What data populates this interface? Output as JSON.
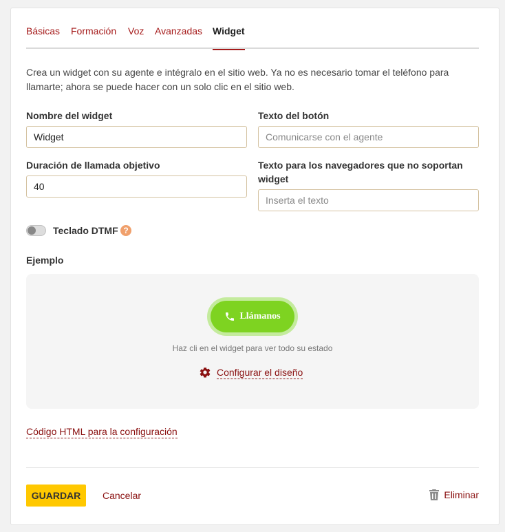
{
  "tabs": [
    {
      "label": "Básicas",
      "active": false
    },
    {
      "label": "Formación",
      "active": false
    },
    {
      "label": "Voz",
      "active": false
    },
    {
      "label": "Avanzadas",
      "active": false
    },
    {
      "label": "Widget",
      "active": true
    }
  ],
  "description": "Crea un widget con su agente e intégralo en el sitio web. Ya no es necesario tomar el teléfono para llamarte; ahora se puede hacer con un solo clic en el sitio web.",
  "form": {
    "widget_name": {
      "label": "Nombre del widget",
      "value": "Widget",
      "placeholder": ""
    },
    "button_text": {
      "label": "Texto del botón",
      "value": "",
      "placeholder": "Comunicarse con el agente"
    },
    "call_duration": {
      "label": "Duración de llamada objetivo",
      "value": "40",
      "placeholder": ""
    },
    "unsupported_text": {
      "label": "Texto para los navegadores que no soportan widget",
      "value": "",
      "placeholder": "Inserta el texto"
    },
    "dtmf": {
      "label": "Teclado DTMF",
      "enabled": false,
      "help": "?"
    }
  },
  "example": {
    "title": "Ejemplo",
    "call_button_label": "Llámanos",
    "hint": "Haz cli en el widget para ver todo su estado",
    "configure_label": "Configurar el diseño"
  },
  "html_code_link": "Código HTML para la configuración",
  "actions": {
    "save_label": "GUARDAR",
    "cancel_label": "Cancelar",
    "delete_label": "Eliminar"
  },
  "colors": {
    "accent": "#a51a1a",
    "primary_button": "#ffc800",
    "widget_green": "#7ed321"
  }
}
